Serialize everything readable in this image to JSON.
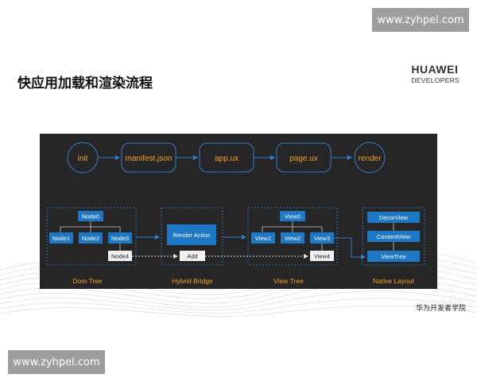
{
  "watermark": {
    "top": "www.zyhpel.com",
    "bottom": "www.zyhpel.com"
  },
  "slide_title": "快应用加载和渲染流程",
  "brand": {
    "line1": "HUAWEI",
    "line2": "DEVELOPERS"
  },
  "footer_text": "华为开发者学院",
  "diagram": {
    "pipeline": [
      "init",
      "manifest.json",
      "app.ux",
      "page.ux",
      "render"
    ],
    "dom_tree": {
      "label": "Dom Tree",
      "root": "Node0",
      "children": [
        "Node1",
        "Node2",
        "Node3"
      ],
      "added": "Node4"
    },
    "hybrid_bridge": {
      "label": "Hybrid Bridge",
      "action": "Render Action",
      "op": "Add"
    },
    "view_tree": {
      "label": "View Tree",
      "root": "View0",
      "children": [
        "View1",
        "View2",
        "View3"
      ],
      "added": "View4"
    },
    "native_layout": {
      "label": "Native Layout",
      "items": [
        "DecorView",
        "ContentView",
        "ViewTree"
      ]
    }
  },
  "colors": {
    "panel_bg": "#262626",
    "accent_orange": "#f0a020",
    "node_blue": "#1e78c8",
    "border_blue": "#2f7fd1",
    "added_node_bg": "#f2f2f2",
    "page_bg": "#ffffff",
    "watermark_bg": "#9e9e9e"
  }
}
